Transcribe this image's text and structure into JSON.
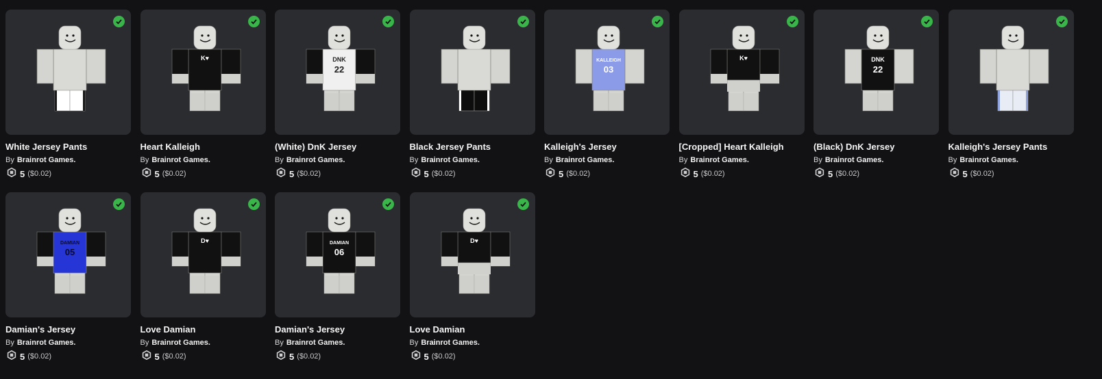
{
  "colors": {
    "background": "#121215",
    "card_bg": "#2b2c30",
    "owned_check": "#39b54a",
    "skin": "#d0d0cc"
  },
  "items": [
    {
      "name": "White Jersey Pants",
      "by": "By",
      "creator": "Brainrot Games.",
      "price": "5",
      "usd": "($0.02)",
      "owned": true,
      "icon": "owned-check-icon",
      "outfit": {
        "torso": "#d9d9d5",
        "arms": "#d4d4d0",
        "legs": "#ffffff",
        "leg_trim": "#1a1a1a",
        "torso_text": "",
        "torso_num": "",
        "text_color": "#ffffff"
      }
    },
    {
      "name": "Heart Kalleigh",
      "by": "By",
      "creator": "Brainrot Games.",
      "price": "5",
      "usd": "($0.02)",
      "owned": true,
      "icon": "owned-check-icon",
      "outfit": {
        "torso": "#111111",
        "arms": "#111111",
        "legs": "#d4d4d0",
        "leg_trim": "",
        "torso_text": "K♥",
        "torso_num": "",
        "text_color": "#ffffff"
      }
    },
    {
      "name": "(White) DnK Jersey",
      "by": "By",
      "creator": "Brainrot Games.",
      "price": "5",
      "usd": "($0.02)",
      "owned": true,
      "icon": "owned-check-icon",
      "outfit": {
        "torso": "#f0f0f0",
        "arms": "#111111",
        "legs": "#d4d4d0",
        "leg_trim": "",
        "torso_text": "DNK",
        "torso_num": "22",
        "text_color": "#222222"
      }
    },
    {
      "name": "Black Jersey Pants",
      "by": "By",
      "creator": "Brainrot Games.",
      "price": "5",
      "usd": "($0.02)",
      "owned": true,
      "icon": "owned-check-icon",
      "outfit": {
        "torso": "#d9d9d5",
        "arms": "#d4d4d0",
        "legs": "#0d0d0d",
        "leg_trim": "#ffffff",
        "torso_text": "",
        "torso_num": "",
        "text_color": "#ffffff"
      }
    },
    {
      "name": "Kalleigh's Jersey",
      "by": "By",
      "creator": "Brainrot Games.",
      "price": "5",
      "usd": "($0.02)",
      "owned": true,
      "icon": "owned-check-icon",
      "outfit": {
        "torso": "#8c9be8",
        "arms": "#d4d4d0",
        "legs": "#d4d4d0",
        "leg_trim": "",
        "torso_text": "KALLEIGH",
        "torso_num": "03",
        "text_color": "#ffffff"
      }
    },
    {
      "name": "[Cropped] Heart Kalleigh",
      "by": "By",
      "creator": "Brainrot Games.",
      "price": "5",
      "usd": "($0.02)",
      "owned": true,
      "icon": "owned-check-icon",
      "outfit": {
        "torso": "#111111",
        "arms": "#111111",
        "legs": "#d4d4d0",
        "leg_trim": "",
        "torso_text": "K♥",
        "torso_num": "",
        "text_color": "#ffffff",
        "cropped": true
      }
    },
    {
      "name": "(Black) DnK Jersey",
      "by": "By",
      "creator": "Brainrot Games.",
      "price": "5",
      "usd": "($0.02)",
      "owned": true,
      "icon": "owned-check-icon",
      "outfit": {
        "torso": "#111111",
        "arms": "#d4d4d0",
        "legs": "#d4d4d0",
        "leg_trim": "",
        "torso_text": "DNK",
        "torso_num": "22",
        "text_color": "#ffffff"
      }
    },
    {
      "name": "Kalleigh's Jersey Pants",
      "by": "By",
      "creator": "Brainrot Games.",
      "price": "5",
      "usd": "($0.02)",
      "owned": true,
      "icon": "owned-check-icon",
      "outfit": {
        "torso": "#d9d9d5",
        "arms": "#d4d4d0",
        "legs": "#e8ecf4",
        "leg_trim": "#8ea2e0",
        "torso_text": "",
        "torso_num": "",
        "text_color": "#ffffff"
      }
    },
    {
      "name": "Damian's Jersey",
      "by": "By",
      "creator": "Brainrot Games.",
      "price": "5",
      "usd": "($0.02)",
      "owned": true,
      "icon": "owned-check-icon",
      "outfit": {
        "torso": "#2636d6",
        "arms": "#111111",
        "legs": "#d4d4d0",
        "leg_trim": "",
        "torso_text": "DAMIAN",
        "torso_num": "05",
        "text_color": "#0a0a30"
      }
    },
    {
      "name": "Love Damian",
      "by": "By",
      "creator": "Brainrot Games.",
      "price": "5",
      "usd": "($0.02)",
      "owned": true,
      "icon": "owned-check-icon",
      "outfit": {
        "torso": "#111111",
        "arms": "#111111",
        "legs": "#d4d4d0",
        "leg_trim": "",
        "torso_text": "D♥",
        "torso_num": "",
        "text_color": "#ffffff"
      }
    },
    {
      "name": "Damian's Jersey",
      "by": "By",
      "creator": "Brainrot Games.",
      "price": "5",
      "usd": "($0.02)",
      "owned": true,
      "icon": "owned-check-icon",
      "outfit": {
        "torso": "#111111",
        "arms": "#111111",
        "legs": "#d4d4d0",
        "leg_trim": "",
        "torso_text": "DAMIAN",
        "torso_num": "06",
        "text_color": "#ffffff"
      }
    },
    {
      "name": "Love Damian",
      "by": "By",
      "creator": "Brainrot Games.",
      "price": "5",
      "usd": "($0.02)",
      "owned": true,
      "icon": "owned-check-icon",
      "outfit": {
        "torso": "#111111",
        "arms": "#111111",
        "legs": "#d4d4d0",
        "leg_trim": "",
        "torso_text": "D♥",
        "torso_num": "",
        "text_color": "#ffffff",
        "cropped": true
      }
    }
  ]
}
